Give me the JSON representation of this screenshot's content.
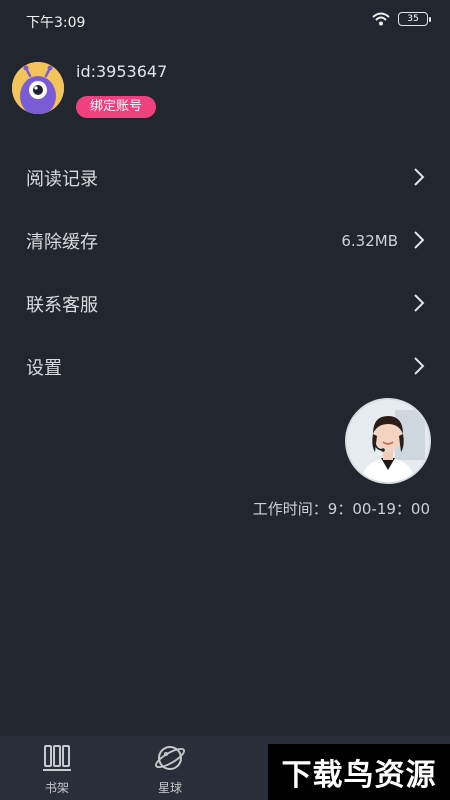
{
  "status_bar": {
    "time": "下午3:09",
    "battery": "35"
  },
  "profile": {
    "user_id": "id:3953647",
    "bind_label": "绑定账号"
  },
  "menu": [
    {
      "label": "阅读记录",
      "value": ""
    },
    {
      "label": "清除缓存",
      "value": "6.32MB"
    },
    {
      "label": "联系客服",
      "value": ""
    },
    {
      "label": "设置",
      "value": ""
    }
  ],
  "support": {
    "work_hours": "工作时间：9：00-19：00"
  },
  "tabbar": {
    "tabs": [
      {
        "label": "书架",
        "icon": "bookshelf-icon"
      },
      {
        "label": "星球",
        "icon": "planet-icon"
      }
    ]
  },
  "watermark": "下载鸟资源",
  "colors": {
    "background": "#22262f",
    "accent": "#f0417e",
    "tabbar": "#2a2e38"
  }
}
